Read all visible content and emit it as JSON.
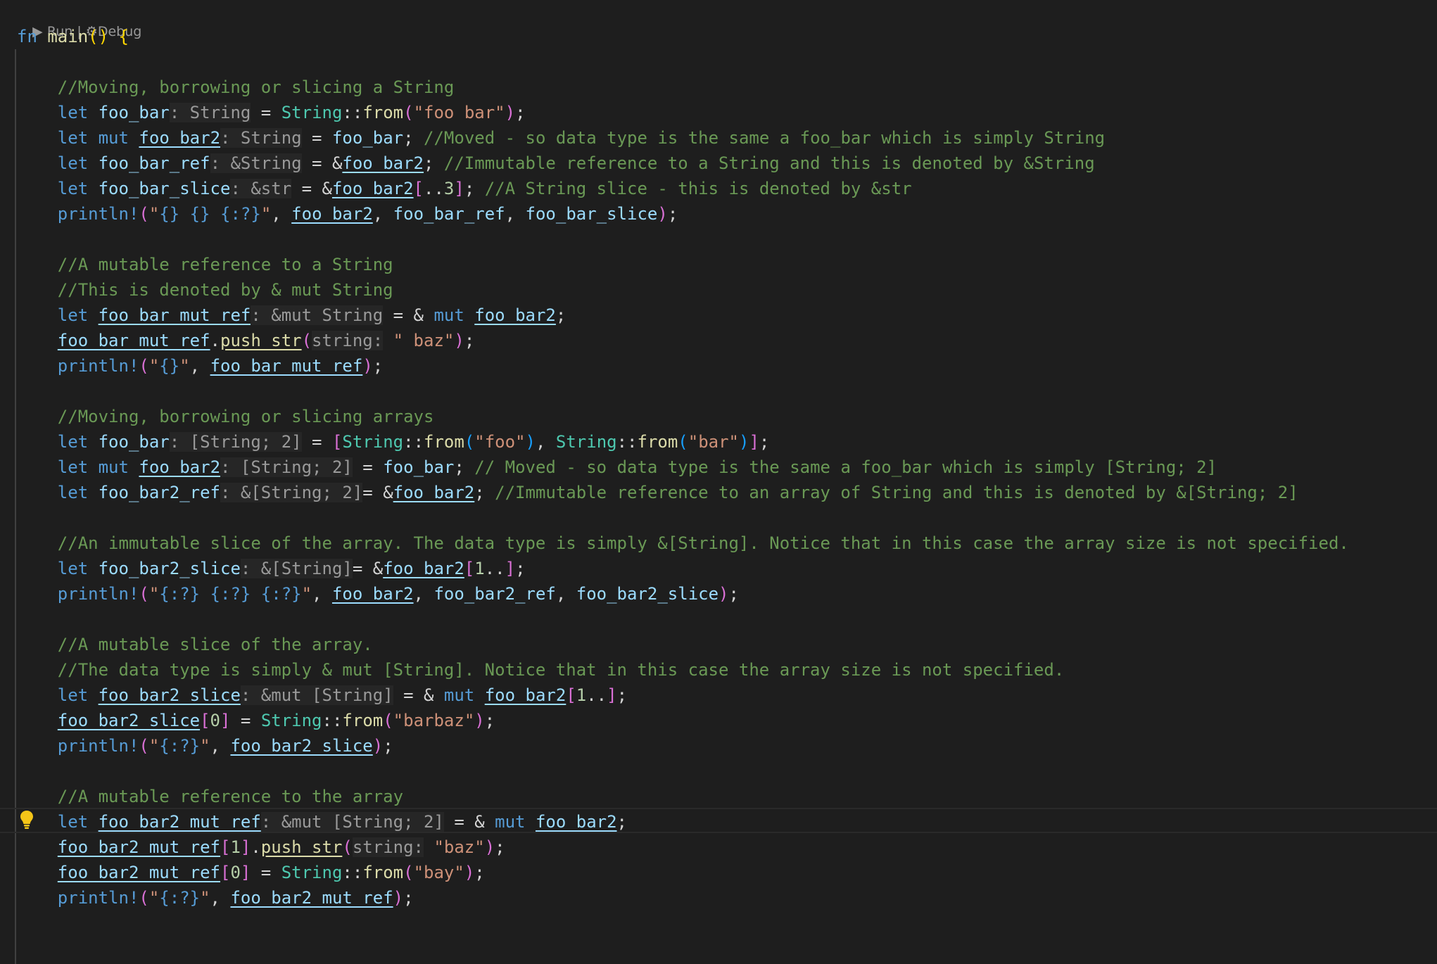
{
  "codelens": {
    "run": "Run",
    "separator": "|",
    "debug": "Debug"
  },
  "lines": [
    [
      [
        "k",
        "fn"
      ],
      [
        "p",
        " "
      ],
      [
        "f",
        "main"
      ],
      [
        "bkt1",
        "()"
      ],
      [
        "p",
        " "
      ],
      [
        "bkt1",
        "{"
      ]
    ],
    [],
    [
      [
        "p",
        "    "
      ],
      [
        "c",
        "//Moving, borrowing or slicing a String"
      ]
    ],
    [
      [
        "p",
        "    "
      ],
      [
        "k",
        "let"
      ],
      [
        "p",
        " "
      ],
      [
        "v",
        "foo_bar"
      ],
      [
        "h",
        ": String"
      ],
      [
        "p",
        " = "
      ],
      [
        "t",
        "String"
      ],
      [
        "p",
        "::"
      ],
      [
        "f",
        "from"
      ],
      [
        "bkt2",
        "("
      ],
      [
        "s",
        "\"foo bar\""
      ],
      [
        "bkt2",
        ")"
      ],
      [
        "p",
        ";"
      ]
    ],
    [
      [
        "p",
        "    "
      ],
      [
        "k",
        "let"
      ],
      [
        "p",
        " "
      ],
      [
        "k",
        "mut"
      ],
      [
        "p",
        " "
      ],
      [
        "vu",
        "foo_bar2"
      ],
      [
        "h",
        ": String"
      ],
      [
        "p",
        " = "
      ],
      [
        "v",
        "foo_bar"
      ],
      [
        "p",
        "; "
      ],
      [
        "c",
        "//Moved - so data type is the same a foo_bar which is simply String"
      ]
    ],
    [
      [
        "p",
        "    "
      ],
      [
        "k",
        "let"
      ],
      [
        "p",
        " "
      ],
      [
        "v",
        "foo_bar_ref"
      ],
      [
        "h",
        ": &String"
      ],
      [
        "p",
        " = &"
      ],
      [
        "vu",
        "foo_bar2"
      ],
      [
        "p",
        "; "
      ],
      [
        "c",
        "//Immutable reference to a String and this is denoted by &String"
      ]
    ],
    [
      [
        "p",
        "    "
      ],
      [
        "k",
        "let"
      ],
      [
        "p",
        " "
      ],
      [
        "v",
        "foo_bar_slice"
      ],
      [
        "h",
        ": &str"
      ],
      [
        "p",
        " = &"
      ],
      [
        "vu",
        "foo_bar2"
      ],
      [
        "bkt2",
        "["
      ],
      [
        "p",
        ".."
      ],
      [
        "n",
        "3"
      ],
      [
        "bkt2",
        "]"
      ],
      [
        "p",
        "; "
      ],
      [
        "c",
        "//A String slice - this is denoted by &str"
      ]
    ],
    [
      [
        "p",
        "    "
      ],
      [
        "m",
        "println!"
      ],
      [
        "bkt2",
        "("
      ],
      [
        "s",
        "\""
      ],
      [
        "m",
        "{}"
      ],
      [
        "p",
        " "
      ],
      [
        "m",
        "{}"
      ],
      [
        "p",
        " "
      ],
      [
        "m",
        "{:?}"
      ],
      [
        "s",
        "\""
      ],
      [
        "p",
        ", "
      ],
      [
        "vu",
        "foo_bar2"
      ],
      [
        "p",
        ", "
      ],
      [
        "v",
        "foo_bar_ref"
      ],
      [
        "p",
        ", "
      ],
      [
        "v",
        "foo_bar_slice"
      ],
      [
        "bkt2",
        ")"
      ],
      [
        "p",
        ";"
      ]
    ],
    [],
    [
      [
        "p",
        "    "
      ],
      [
        "c",
        "//A mutable reference to a String"
      ]
    ],
    [
      [
        "p",
        "    "
      ],
      [
        "c",
        "//This is denoted by & mut String"
      ]
    ],
    [
      [
        "p",
        "    "
      ],
      [
        "k",
        "let"
      ],
      [
        "p",
        " "
      ],
      [
        "vu",
        "foo_bar_mut_ref"
      ],
      [
        "h",
        ": &mut String"
      ],
      [
        "p",
        " = & "
      ],
      [
        "k",
        "mut"
      ],
      [
        "p",
        " "
      ],
      [
        "vu",
        "foo_bar2"
      ],
      [
        "p",
        ";"
      ]
    ],
    [
      [
        "p",
        "    "
      ],
      [
        "vu",
        "foo_bar_mut_ref"
      ],
      [
        "p",
        "."
      ],
      [
        "fu",
        "push_str"
      ],
      [
        "bkt2",
        "("
      ],
      [
        "h",
        "string:"
      ],
      [
        "s",
        " \" baz\""
      ],
      [
        "bkt2",
        ")"
      ],
      [
        "p",
        ";"
      ]
    ],
    [
      [
        "p",
        "    "
      ],
      [
        "m",
        "println!"
      ],
      [
        "bkt2",
        "("
      ],
      [
        "s",
        "\""
      ],
      [
        "m",
        "{}"
      ],
      [
        "s",
        "\""
      ],
      [
        "p",
        ", "
      ],
      [
        "vu",
        "foo_bar_mut_ref"
      ],
      [
        "bkt2",
        ")"
      ],
      [
        "p",
        ";"
      ]
    ],
    [],
    [
      [
        "p",
        "    "
      ],
      [
        "c",
        "//Moving, borrowing or slicing arrays"
      ]
    ],
    [
      [
        "p",
        "    "
      ],
      [
        "k",
        "let"
      ],
      [
        "p",
        " "
      ],
      [
        "v",
        "foo_bar"
      ],
      [
        "h",
        ": [String; 2]"
      ],
      [
        "p",
        " = "
      ],
      [
        "bkt2",
        "["
      ],
      [
        "t",
        "String"
      ],
      [
        "p",
        "::"
      ],
      [
        "f",
        "from"
      ],
      [
        "bkt3",
        "("
      ],
      [
        "s",
        "\"foo\""
      ],
      [
        "bkt3",
        ")"
      ],
      [
        "p",
        ", "
      ],
      [
        "t",
        "String"
      ],
      [
        "p",
        "::"
      ],
      [
        "f",
        "from"
      ],
      [
        "bkt3",
        "("
      ],
      [
        "s",
        "\"bar\""
      ],
      [
        "bkt3",
        ")"
      ],
      [
        "bkt2",
        "]"
      ],
      [
        "p",
        ";"
      ]
    ],
    [
      [
        "p",
        "    "
      ],
      [
        "k",
        "let"
      ],
      [
        "p",
        " "
      ],
      [
        "k",
        "mut"
      ],
      [
        "p",
        " "
      ],
      [
        "vu",
        "foo_bar2"
      ],
      [
        "h",
        ": [String; 2]"
      ],
      [
        "p",
        " = "
      ],
      [
        "v",
        "foo_bar"
      ],
      [
        "p",
        "; "
      ],
      [
        "c",
        "// Moved - so data type is the same a foo_bar which is simply [String; 2]"
      ]
    ],
    [
      [
        "p",
        "    "
      ],
      [
        "k",
        "let"
      ],
      [
        "p",
        " "
      ],
      [
        "v",
        "foo_bar2_ref"
      ],
      [
        "h",
        ": &[String; 2]"
      ],
      [
        "p",
        "= &"
      ],
      [
        "vu",
        "foo_bar2"
      ],
      [
        "p",
        "; "
      ],
      [
        "c",
        "//Immutable reference to an array of String and this is denoted by &[String; 2]"
      ]
    ],
    [],
    [
      [
        "p",
        "    "
      ],
      [
        "c",
        "//An immutable slice of the array. The data type is simply &[String]. Notice that in this case the array size is not specified."
      ]
    ],
    [
      [
        "p",
        "    "
      ],
      [
        "k",
        "let"
      ],
      [
        "p",
        " "
      ],
      [
        "v",
        "foo_bar2_slice"
      ],
      [
        "h",
        ": &[String]"
      ],
      [
        "p",
        "= &"
      ],
      [
        "vu",
        "foo_bar2"
      ],
      [
        "bkt2",
        "["
      ],
      [
        "n",
        "1"
      ],
      [
        "p",
        ".."
      ],
      [
        "bkt2",
        "]"
      ],
      [
        "p",
        ";"
      ]
    ],
    [
      [
        "p",
        "    "
      ],
      [
        "m",
        "println!"
      ],
      [
        "bkt2",
        "("
      ],
      [
        "s",
        "\""
      ],
      [
        "m",
        "{:?}"
      ],
      [
        "p",
        " "
      ],
      [
        "m",
        "{:?}"
      ],
      [
        "p",
        " "
      ],
      [
        "m",
        "{:?}"
      ],
      [
        "s",
        "\""
      ],
      [
        "p",
        ", "
      ],
      [
        "vu",
        "foo_bar2"
      ],
      [
        "p",
        ", "
      ],
      [
        "v",
        "foo_bar2_ref"
      ],
      [
        "p",
        ", "
      ],
      [
        "v",
        "foo_bar2_slice"
      ],
      [
        "bkt2",
        ")"
      ],
      [
        "p",
        ";"
      ]
    ],
    [],
    [
      [
        "p",
        "    "
      ],
      [
        "c",
        "//A mutable slice of the array."
      ]
    ],
    [
      [
        "p",
        "    "
      ],
      [
        "c",
        "//The data type is simply & mut [String]. Notice that in this case the array size is not specified."
      ]
    ],
    [
      [
        "p",
        "    "
      ],
      [
        "k",
        "let"
      ],
      [
        "p",
        " "
      ],
      [
        "vu",
        "foo_bar2_slice"
      ],
      [
        "h",
        ": &mut [String]"
      ],
      [
        "p",
        " = & "
      ],
      [
        "k",
        "mut"
      ],
      [
        "p",
        " "
      ],
      [
        "vu",
        "foo_bar2"
      ],
      [
        "bkt2",
        "["
      ],
      [
        "n",
        "1"
      ],
      [
        "p",
        ".."
      ],
      [
        "bkt2",
        "]"
      ],
      [
        "p",
        ";"
      ]
    ],
    [
      [
        "p",
        "    "
      ],
      [
        "vu",
        "foo_bar2_slice"
      ],
      [
        "bkt2",
        "["
      ],
      [
        "n",
        "0"
      ],
      [
        "bkt2",
        "]"
      ],
      [
        "p",
        " = "
      ],
      [
        "t",
        "String"
      ],
      [
        "p",
        "::"
      ],
      [
        "f",
        "from"
      ],
      [
        "bkt2",
        "("
      ],
      [
        "s",
        "\"barbaz\""
      ],
      [
        "bkt2",
        ")"
      ],
      [
        "p",
        ";"
      ]
    ],
    [
      [
        "p",
        "    "
      ],
      [
        "m",
        "println!"
      ],
      [
        "bkt2",
        "("
      ],
      [
        "s",
        "\""
      ],
      [
        "m",
        "{:?}"
      ],
      [
        "s",
        "\""
      ],
      [
        "p",
        ", "
      ],
      [
        "vu",
        "foo_bar2_slice"
      ],
      [
        "bkt2",
        ")"
      ],
      [
        "p",
        ";"
      ]
    ],
    [],
    [
      [
        "p",
        "    "
      ],
      [
        "c",
        "//A mutable reference to the array"
      ]
    ],
    [
      [
        "p",
        "    "
      ],
      [
        "k",
        "let"
      ],
      [
        "p",
        " "
      ],
      [
        "vu",
        "foo_bar2_mut_ref"
      ],
      [
        "h",
        ": &mut [String; 2]"
      ],
      [
        "p",
        " = & "
      ],
      [
        "k",
        "mut"
      ],
      [
        "p",
        " "
      ],
      [
        "vu",
        "foo_bar2"
      ],
      [
        "p",
        ";"
      ]
    ],
    [
      [
        "p",
        "    "
      ],
      [
        "vu",
        "foo_bar2_mut_ref"
      ],
      [
        "bkt2",
        "["
      ],
      [
        "n",
        "1"
      ],
      [
        "bkt2",
        "]"
      ],
      [
        "p",
        "."
      ],
      [
        "fu",
        "push_str"
      ],
      [
        "bkt2",
        "("
      ],
      [
        "h",
        "string:"
      ],
      [
        "s",
        " \"baz\""
      ],
      [
        "bkt2",
        ")"
      ],
      [
        "p",
        ";"
      ]
    ],
    [
      [
        "p",
        "    "
      ],
      [
        "vu",
        "foo_bar2_mut_ref"
      ],
      [
        "bkt2",
        "["
      ],
      [
        "n",
        "0"
      ],
      [
        "bkt2",
        "]"
      ],
      [
        "p",
        " = "
      ],
      [
        "t",
        "String"
      ],
      [
        "p",
        "::"
      ],
      [
        "f",
        "from"
      ],
      [
        "bkt2",
        "("
      ],
      [
        "s",
        "\"bay\""
      ],
      [
        "bkt2",
        ")"
      ],
      [
        "p",
        ";"
      ]
    ],
    [
      [
        "p",
        "    "
      ],
      [
        "m",
        "println!"
      ],
      [
        "bkt2",
        "("
      ],
      [
        "s",
        "\""
      ],
      [
        "m",
        "{:?}"
      ],
      [
        "s",
        "\""
      ],
      [
        "p",
        ", "
      ],
      [
        "vu",
        "foo_bar2_mut_ref"
      ],
      [
        "bkt2",
        ")"
      ],
      [
        "p",
        ";"
      ]
    ]
  ],
  "colors": {
    "background": "#1e1e1e",
    "keyword": "#569cd6",
    "function": "#dcdcaa",
    "type": "#4ec9b0",
    "variable": "#9cdcfe",
    "string": "#ce9178",
    "comment": "#6a9955",
    "number": "#b5cea8",
    "lightbulb": "#f5c518"
  },
  "icons": {
    "run": "play-icon",
    "debug": "gear-icon",
    "hint": "lightbulb-icon"
  }
}
